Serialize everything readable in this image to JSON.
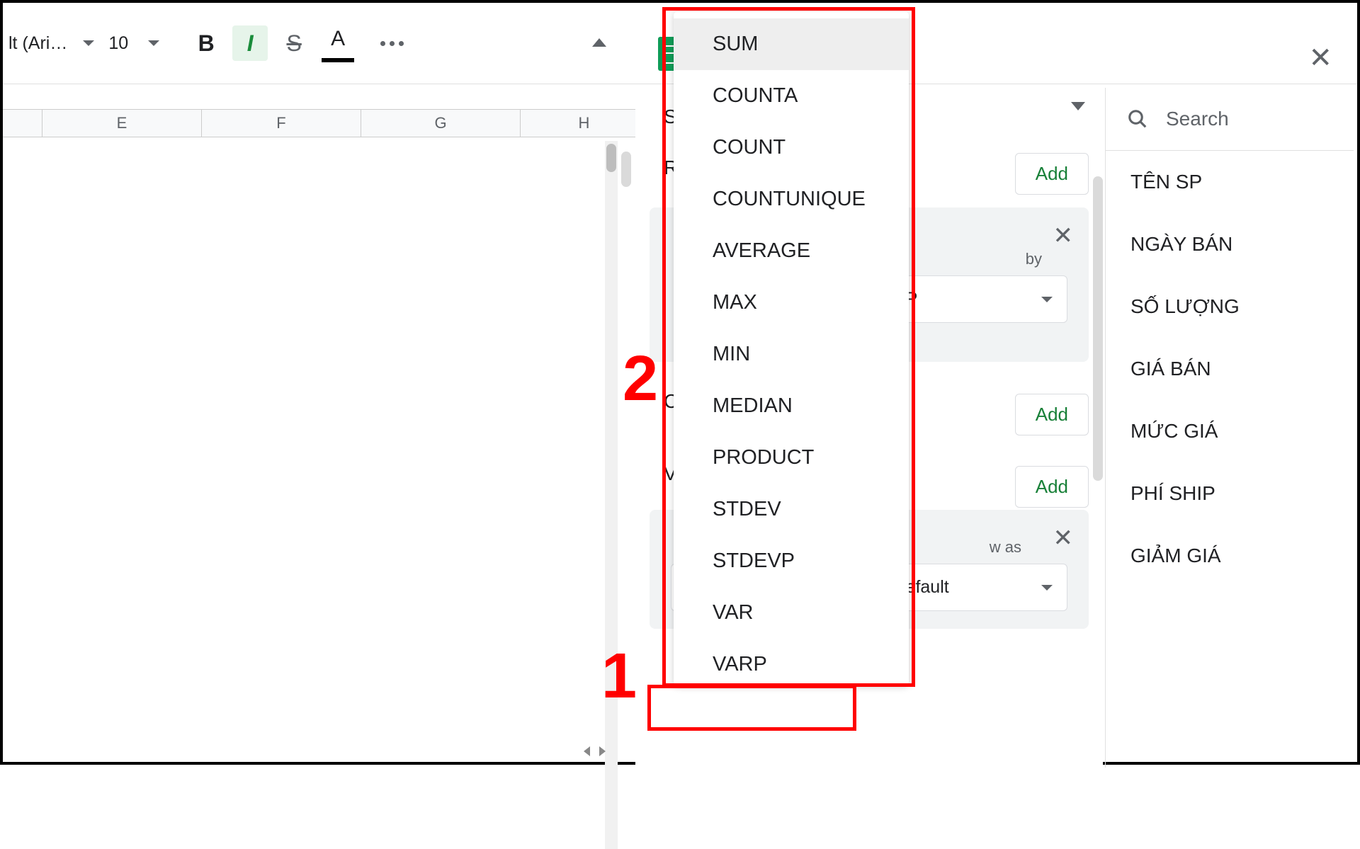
{
  "toolbar": {
    "font_name": "lt (Ari…",
    "font_size": "10",
    "bold": "B",
    "italic": "I",
    "strike": "S",
    "text_color": "A"
  },
  "columns": [
    "E",
    "F",
    "G",
    "H"
  ],
  "panel": {
    "s_label": "S",
    "r_label": "R",
    "add": "Add",
    "card1_sortby_label": "by",
    "card1_sortby_value": "N SP",
    "c_label": "C",
    "v_label": "V",
    "showas_label": "w as",
    "summarize_select": "SUM",
    "showas_select": "Default"
  },
  "dropdown_items": [
    "SUM",
    "COUNTA",
    "COUNT",
    "COUNTUNIQUE",
    "AVERAGE",
    "MAX",
    "MIN",
    "MEDIAN",
    "PRODUCT",
    "STDEV",
    "STDEVP",
    "VAR",
    "VARP"
  ],
  "search_placeholder": "Search",
  "fields": [
    "TÊN SP",
    "NGÀY BÁN",
    "SỐ LƯỢNG",
    "GIÁ BÁN",
    "MỨC GIÁ",
    "PHÍ SHIP",
    "GIẢM GIÁ"
  ],
  "annotations": {
    "n1": "1",
    "n2": "2"
  }
}
